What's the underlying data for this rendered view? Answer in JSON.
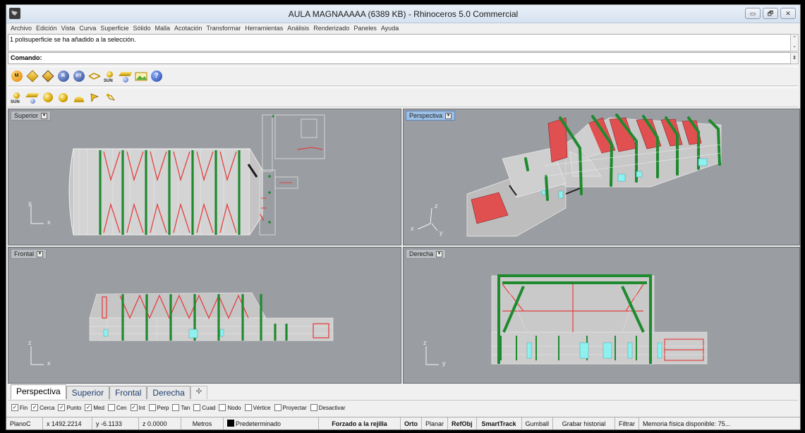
{
  "window": {
    "title": "AULA MAGNAAAAA (6389 KB) - Rhinoceros 5.0 Commercial",
    "buttons": [
      "▭",
      "🗗",
      "✕"
    ]
  },
  "menu": [
    "Archivo",
    "Edición",
    "Vista",
    "Curva",
    "Superficie",
    "Sólido",
    "Malla",
    "Acotación",
    "Transformar",
    "Herramientas",
    "Análisis",
    "Renderizado",
    "Paneles",
    "Ayuda"
  ],
  "command": {
    "history": "1 polisuperficie se ha añadido a la selección.",
    "label": "Comando:",
    "value": ""
  },
  "toolbar1": {
    "icons": [
      "maxwell-icon",
      "material-icon",
      "material-edit-icon",
      "render-icon",
      "rt-render-icon",
      "emitter-icon",
      "sun-icon",
      "camera-icon",
      "environment-icon",
      "help-icon"
    ],
    "labels": {
      "maxwell": "M",
      "render": "R",
      "rt": "RT",
      "help": "?",
      "sun": "SUN"
    }
  },
  "toolbar2": {
    "icons": [
      "sun-light-icon",
      "plane-icon",
      "sphere-icon",
      "sphere-small-icon",
      "hemisphere-icon",
      "arrow-flag-icon",
      "pointer-icon"
    ],
    "labels": {
      "sun": "SUN"
    }
  },
  "viewports": {
    "top": {
      "title": "Superior",
      "axis_v": "y",
      "axis_h": "x"
    },
    "perspective": {
      "title": "Perspectiva",
      "axis_v": "z",
      "axis_h": "y",
      "axis_x": "x"
    },
    "front": {
      "title": "Frontal",
      "axis_v": "z",
      "axis_h": "x"
    },
    "right": {
      "title": "Derecha",
      "axis_v": "z",
      "axis_h": "y"
    }
  },
  "viewport_tabs": [
    "Perspectiva",
    "Superior",
    "Frontal",
    "Derecha"
  ],
  "osnaps": [
    {
      "label": "Fin",
      "checked": true
    },
    {
      "label": "Cerca",
      "checked": true
    },
    {
      "label": "Punto",
      "checked": true
    },
    {
      "label": "Med",
      "checked": true
    },
    {
      "label": "Cen",
      "checked": false
    },
    {
      "label": "Int",
      "checked": true
    },
    {
      "label": "Perp",
      "checked": false
    },
    {
      "label": "Tan",
      "checked": false
    },
    {
      "label": "Cuad",
      "checked": false
    },
    {
      "label": "Nodo",
      "checked": false
    },
    {
      "label": "Vértice",
      "checked": false
    },
    {
      "label": "Proyectar",
      "checked": false
    },
    {
      "label": "Desactivar",
      "checked": false
    }
  ],
  "status": {
    "plane": "PlanoC",
    "x": "x 1492.2214",
    "y": "y -6.1133",
    "z": "z 0.0000",
    "units": "Metros",
    "layer": "Predeterminado",
    "grid_snap": "Forzado a la rejilla",
    "ortho": "Orto",
    "planar": "Planar",
    "refobj": "RefObj",
    "smarttrack": "SmartTrack",
    "gumball": "Gumball",
    "history": "Grabar historial",
    "filter": "Filtrar",
    "memory": "Memoria física disponible: 75..."
  },
  "colors": {
    "viewport_bg": "#9a9da2",
    "frame_green": "#1e8a2e",
    "brace_red": "#e34040",
    "wall_gray": "#d6d6d6",
    "glass_cyan": "#8ff0f0",
    "active_viewport_title": "#9dc0e6"
  }
}
